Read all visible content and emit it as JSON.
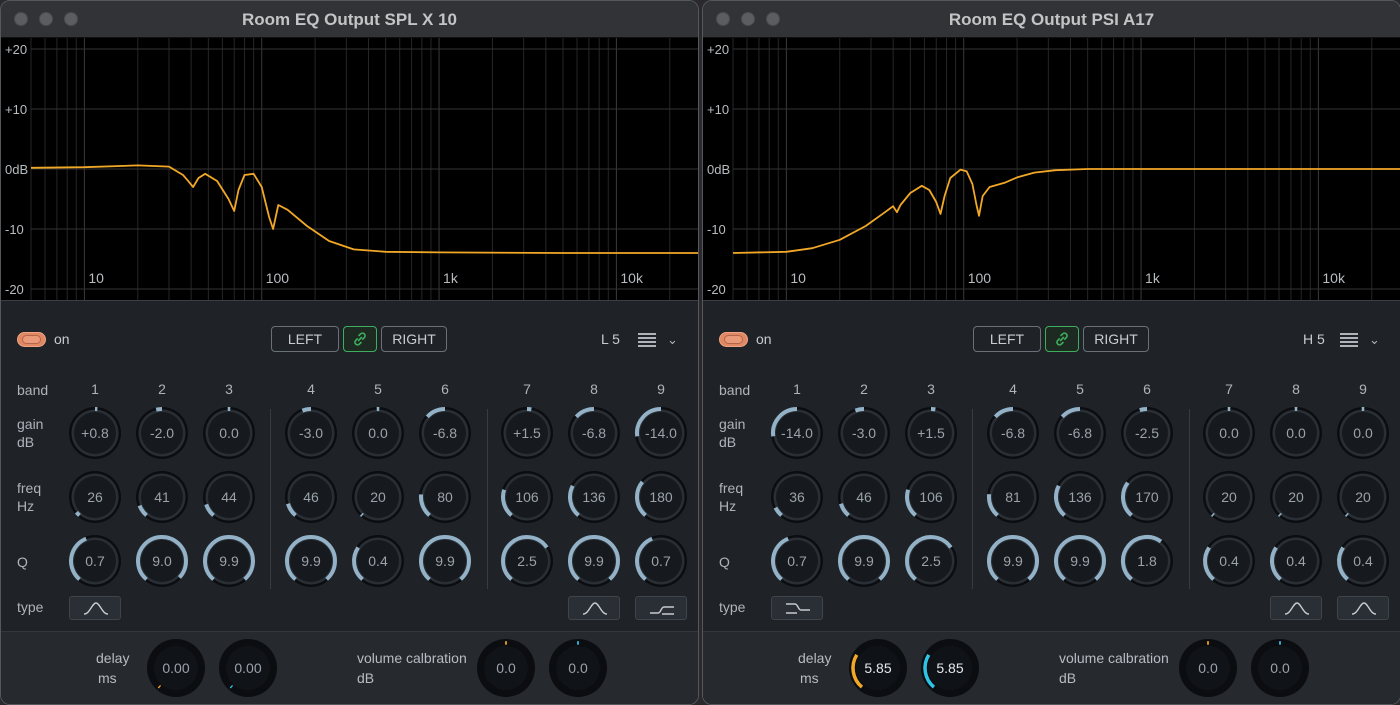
{
  "windows": [
    {
      "title": "Room EQ Output SPL X 10",
      "graph": {
        "y_ticks": [
          "+20",
          "+10",
          "0dB",
          "-10",
          "-20"
        ],
        "x_ticks": [
          "10",
          "100",
          "1k",
          "10k"
        ],
        "curve": [
          [
            5,
            0.2
          ],
          [
            10,
            0.3
          ],
          [
            20,
            0.6
          ],
          [
            30,
            0.4
          ],
          [
            36,
            -1.0
          ],
          [
            38,
            -1.8
          ],
          [
            41,
            -3
          ],
          [
            44,
            -1.5
          ],
          [
            48,
            -0.8
          ],
          [
            56,
            -2
          ],
          [
            65,
            -5
          ],
          [
            70,
            -7
          ],
          [
            74,
            -3.5
          ],
          [
            80,
            -1
          ],
          [
            90,
            -0.8
          ],
          [
            100,
            -3
          ],
          [
            110,
            -8
          ],
          [
            116,
            -10
          ],
          [
            124,
            -6
          ],
          [
            140,
            -6.8
          ],
          [
            180,
            -9.5
          ],
          [
            240,
            -12
          ],
          [
            330,
            -13.4
          ],
          [
            500,
            -13.8
          ],
          [
            1000,
            -13.9
          ],
          [
            5000,
            -14
          ],
          [
            30000,
            -14
          ]
        ],
        "curve_color": "#f2a827"
      },
      "power_label": "on",
      "left_label": "LEFT",
      "right_label": "RIGHT",
      "preset_label": "L 5",
      "row_labels": {
        "band": "band",
        "gain": "gain",
        "gain_unit": "dB",
        "freq": "freq",
        "freq_unit": "Hz",
        "q": "Q",
        "type": "type"
      },
      "bands": [
        {
          "num": "1",
          "gain": "+0.8",
          "gain_value": 0.8,
          "freq": "26",
          "freq_value": 26,
          "q": "0.7",
          "q_value": 0.7
        },
        {
          "num": "2",
          "gain": "-2.0",
          "gain_value": -2.0,
          "freq": "41",
          "freq_value": 41,
          "q": "9.0",
          "q_value": 9.0
        },
        {
          "num": "3",
          "gain": "0.0",
          "gain_value": 0.0,
          "freq": "44",
          "freq_value": 44,
          "q": "9.9",
          "q_value": 9.9
        },
        {
          "num": "4",
          "gain": "-3.0",
          "gain_value": -3.0,
          "freq": "46",
          "freq_value": 46,
          "q": "9.9",
          "q_value": 9.9
        },
        {
          "num": "5",
          "gain": "0.0",
          "gain_value": 0.0,
          "freq": "20",
          "freq_value": 20,
          "q": "0.4",
          "q_value": 0.4
        },
        {
          "num": "6",
          "gain": "-6.8",
          "gain_value": -6.8,
          "freq": "80",
          "freq_value": 80,
          "q": "9.9",
          "q_value": 9.9
        },
        {
          "num": "7",
          "gain": "+1.5",
          "gain_value": 1.5,
          "freq": "106",
          "freq_value": 106,
          "q": "2.5",
          "q_value": 2.5
        },
        {
          "num": "8",
          "gain": "-6.8",
          "gain_value": -6.8,
          "freq": "136",
          "freq_value": 136,
          "q": "9.9",
          "q_value": 9.9
        },
        {
          "num": "9",
          "gain": "-14.0",
          "gain_value": -14.0,
          "freq": "180",
          "freq_value": 180,
          "q": "0.7",
          "q_value": 0.7
        }
      ],
      "types": [
        {
          "band": 1,
          "icon": "bell-filter-icon"
        },
        {
          "band": 8,
          "icon": "bell-filter-icon"
        },
        {
          "band": 9,
          "icon": "high-shelf-filter-icon"
        }
      ],
      "footer": {
        "delay_label": "delay",
        "delay_unit": "ms",
        "delay_values": [
          {
            "text": "0.00",
            "value": 0.0
          },
          {
            "text": "0.00",
            "value": 0.0
          }
        ],
        "volume_label": "volume calbration",
        "volume_unit": "dB",
        "volume_values": [
          {
            "text": "0.0",
            "value": 0.0
          },
          {
            "text": "0.0",
            "value": 0.0
          }
        ]
      }
    },
    {
      "title": "Room EQ Output PSI A17",
      "graph": {
        "y_ticks": [
          "+20",
          "+10",
          "0dB",
          "-10",
          "-20"
        ],
        "x_ticks": [
          "10",
          "100",
          "1k",
          "10k"
        ],
        "curve": [
          [
            5,
            -14
          ],
          [
            10,
            -13.8
          ],
          [
            14,
            -13.2
          ],
          [
            20,
            -11.8
          ],
          [
            28,
            -9.5
          ],
          [
            36,
            -7.2
          ],
          [
            40,
            -6.2
          ],
          [
            42,
            -7.2
          ],
          [
            44,
            -6
          ],
          [
            50,
            -4
          ],
          [
            58,
            -2.8
          ],
          [
            64,
            -3.5
          ],
          [
            70,
            -5.5
          ],
          [
            74,
            -7.5
          ],
          [
            78,
            -4.5
          ],
          [
            84,
            -1.5
          ],
          [
            96,
            -0.1
          ],
          [
            104,
            -0.4
          ],
          [
            112,
            -2.5
          ],
          [
            118,
            -6
          ],
          [
            122,
            -7.8
          ],
          [
            128,
            -4.5
          ],
          [
            140,
            -3
          ],
          [
            170,
            -2.3
          ],
          [
            200,
            -1.4
          ],
          [
            250,
            -0.6
          ],
          [
            330,
            -0.2
          ],
          [
            500,
            0
          ],
          [
            30000,
            0
          ]
        ],
        "curve_color": "#f2a827"
      },
      "power_label": "on",
      "left_label": "LEFT",
      "right_label": "RIGHT",
      "preset_label": "H 5",
      "row_labels": {
        "band": "band",
        "gain": "gain",
        "gain_unit": "dB",
        "freq": "freq",
        "freq_unit": "Hz",
        "q": "Q",
        "type": "type"
      },
      "bands": [
        {
          "num": "1",
          "gain": "-14.0",
          "gain_value": -14.0,
          "freq": "36",
          "freq_value": 36,
          "q": "0.7",
          "q_value": 0.7
        },
        {
          "num": "2",
          "gain": "-3.0",
          "gain_value": -3.0,
          "freq": "46",
          "freq_value": 46,
          "q": "9.9",
          "q_value": 9.9
        },
        {
          "num": "3",
          "gain": "+1.5",
          "gain_value": 1.5,
          "freq": "106",
          "freq_value": 106,
          "q": "2.5",
          "q_value": 2.5
        },
        {
          "num": "4",
          "gain": "-6.8",
          "gain_value": -6.8,
          "freq": "81",
          "freq_value": 81,
          "q": "9.9",
          "q_value": 9.9
        },
        {
          "num": "5",
          "gain": "-6.8",
          "gain_value": -6.8,
          "freq": "136",
          "freq_value": 136,
          "q": "9.9",
          "q_value": 9.9
        },
        {
          "num": "6",
          "gain": "-2.5",
          "gain_value": -2.5,
          "freq": "170",
          "freq_value": 170,
          "q": "1.8",
          "q_value": 1.8
        },
        {
          "num": "7",
          "gain": "0.0",
          "gain_value": 0.0,
          "freq": "20",
          "freq_value": 20,
          "q": "0.4",
          "q_value": 0.4
        },
        {
          "num": "8",
          "gain": "0.0",
          "gain_value": 0.0,
          "freq": "20",
          "freq_value": 20,
          "q": "0.4",
          "q_value": 0.4
        },
        {
          "num": "9",
          "gain": "0.0",
          "gain_value": 0.0,
          "freq": "20",
          "freq_value": 20,
          "q": "0.4",
          "q_value": 0.4
        }
      ],
      "types": [
        {
          "band": 1,
          "icon": "low-shelf-filter-icon"
        },
        {
          "band": 8,
          "icon": "bell-filter-icon"
        },
        {
          "band": 9,
          "icon": "bell-filter-icon"
        }
      ],
      "footer": {
        "delay_label": "delay",
        "delay_unit": "ms",
        "delay_values": [
          {
            "text": "5.85",
            "value": 5.85
          },
          {
            "text": "5.85",
            "value": 5.85
          }
        ],
        "volume_label": "volume calbration",
        "volume_unit": "dB",
        "volume_values": [
          {
            "text": "0.0",
            "value": 0.0
          },
          {
            "text": "0.0",
            "value": 0.0
          }
        ]
      }
    }
  ],
  "colors": {
    "knob_arc": "#93b2c8",
    "knob_track": "#0b0d10",
    "delay_orange": "#f2a827",
    "delay_cyan": "#2ec4e6",
    "link_green": "#3fae5c",
    "power_orange": "#e08863"
  },
  "ranges": {
    "gain": [
      -20,
      20
    ],
    "freq_hz": [
      20,
      20000
    ],
    "q": [
      0.1,
      10
    ],
    "delay_ms": [
      0,
      20
    ],
    "volume_db": [
      -20,
      20
    ]
  }
}
